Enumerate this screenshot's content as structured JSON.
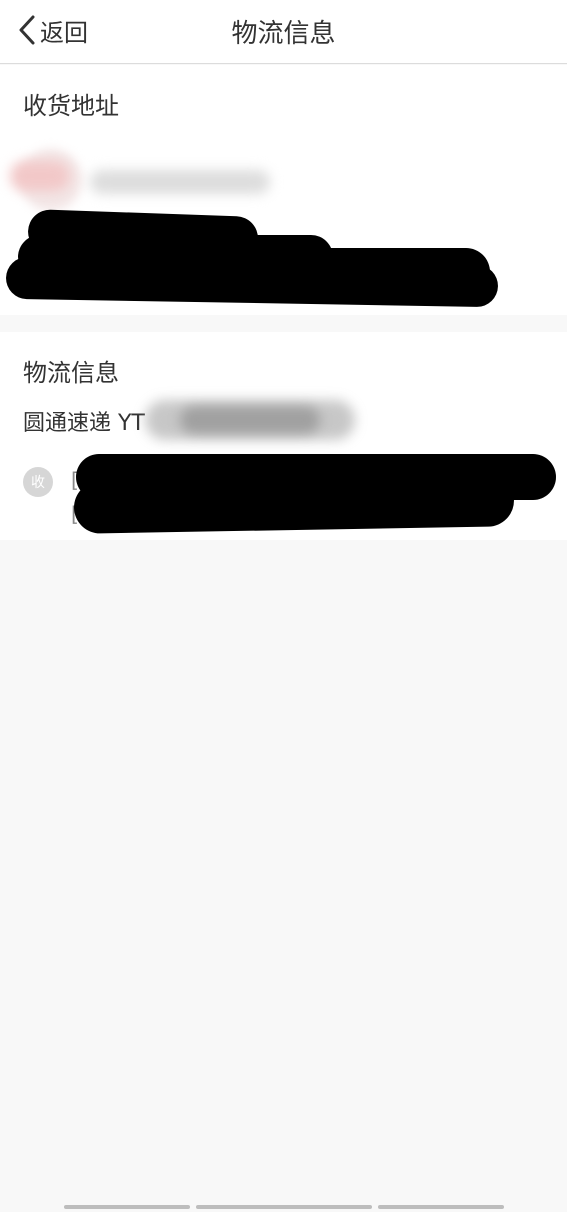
{
  "navbar": {
    "back_label": "返回",
    "title": "物流信息"
  },
  "address": {
    "section_title": "收货地址"
  },
  "logistics": {
    "section_title": "物流信息",
    "carrier_prefix": "圆通速递 YT",
    "receive_badge": "收",
    "bracket_open": "[",
    "bracket_open_2": "["
  }
}
